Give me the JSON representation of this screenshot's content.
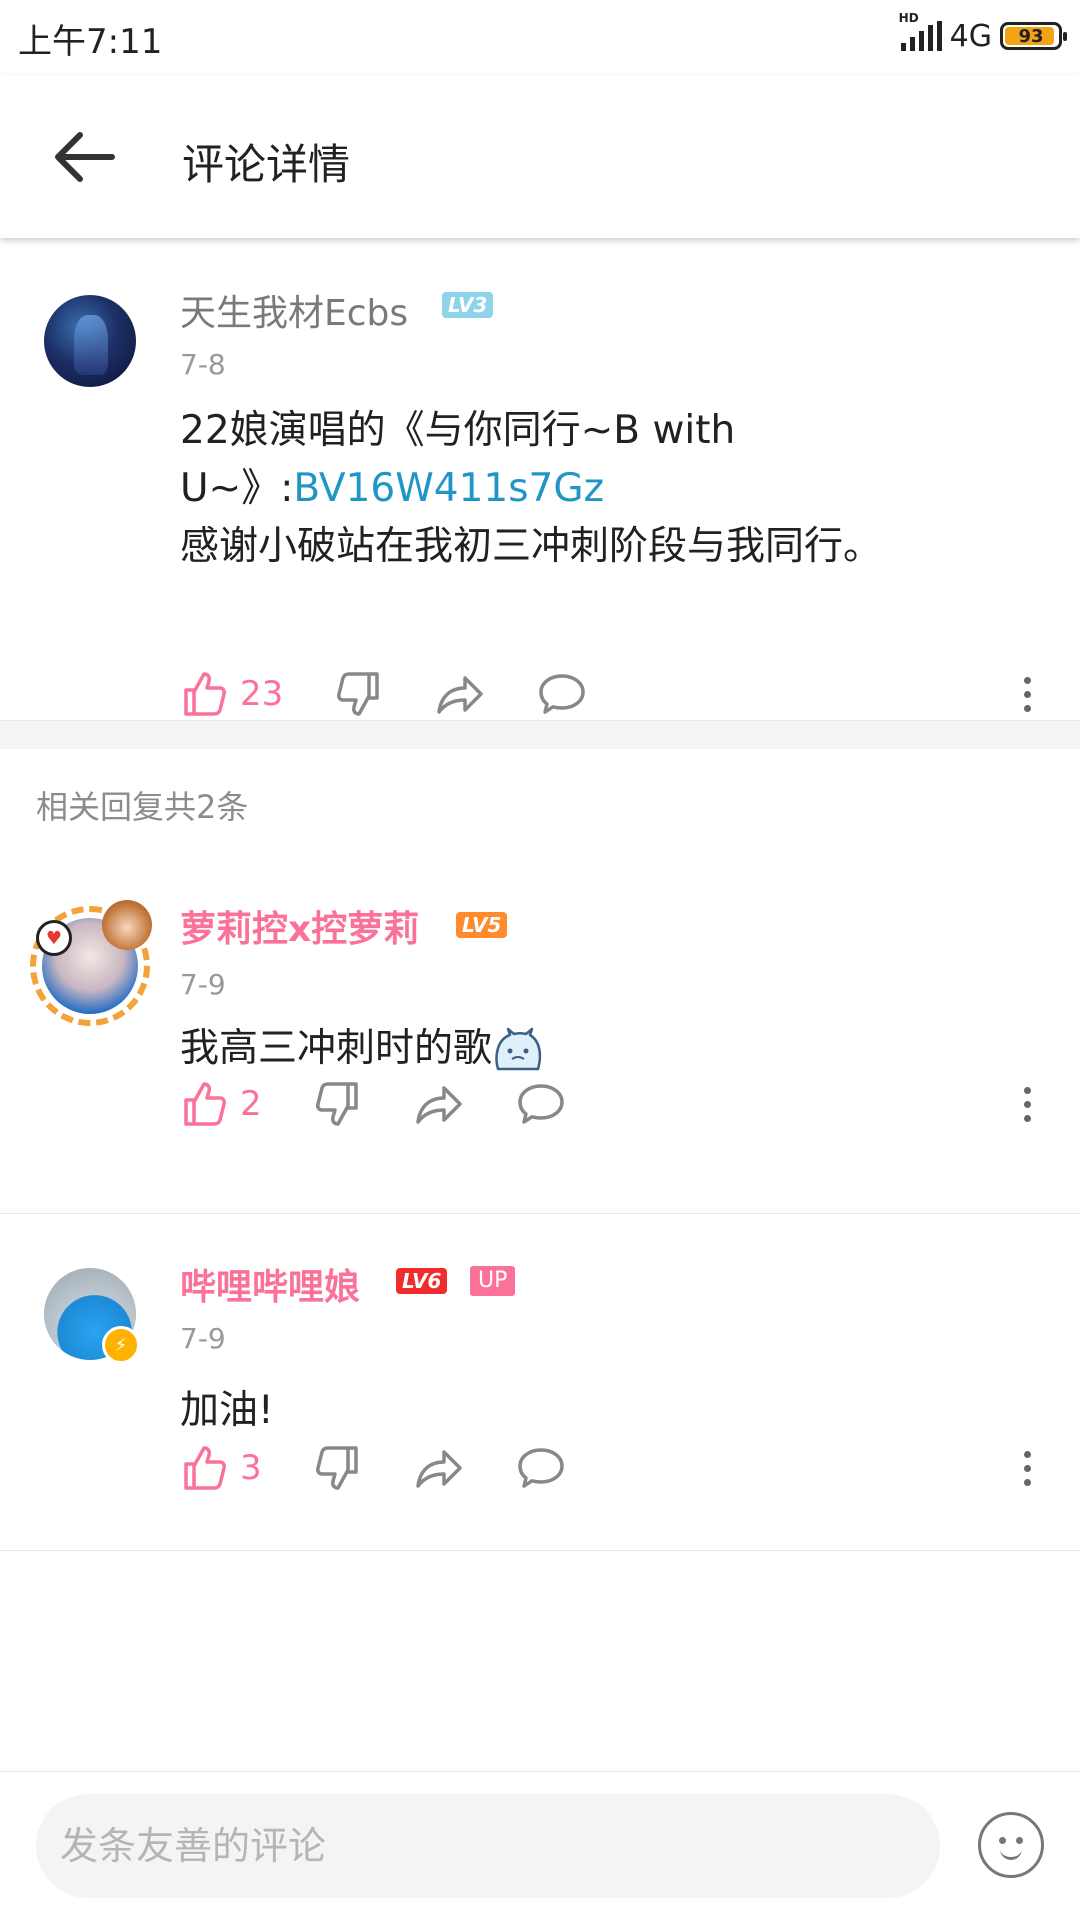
{
  "status_bar": {
    "time": "上午7:11",
    "hd": "HD",
    "network": "4G",
    "battery": "93"
  },
  "header": {
    "title": "评论详情"
  },
  "main_comment": {
    "username": "天生我材Ecbs",
    "level": "LV3",
    "date": "7-8",
    "text_part1": "22娘演唱的《与你同行~B with",
    "text_part2_prefix": "U~》:",
    "text_link": "BV16W411s7Gz",
    "text_part3": "感谢小破站在我初三冲刺阶段与我同行。",
    "likes": "23"
  },
  "replies_header": "相关回复共2条",
  "replies": [
    {
      "username": "萝莉控x控萝莉",
      "level": "LV5",
      "date": "7-9",
      "text": "我高三冲刺时的歌",
      "likes": "2"
    },
    {
      "username": "哔哩哔哩娘",
      "level": "LV6",
      "tag": "UP",
      "date": "7-9",
      "text": "加油!",
      "likes": "3"
    }
  ],
  "bottom_bar": {
    "placeholder": "发条友善的评论"
  },
  "colors": {
    "accent_pink": "#fb7299",
    "link_blue": "#2196c6",
    "lv3": "#8fd3ea",
    "lv5": "#ff8b2c",
    "lv6": "#f22c2c"
  }
}
